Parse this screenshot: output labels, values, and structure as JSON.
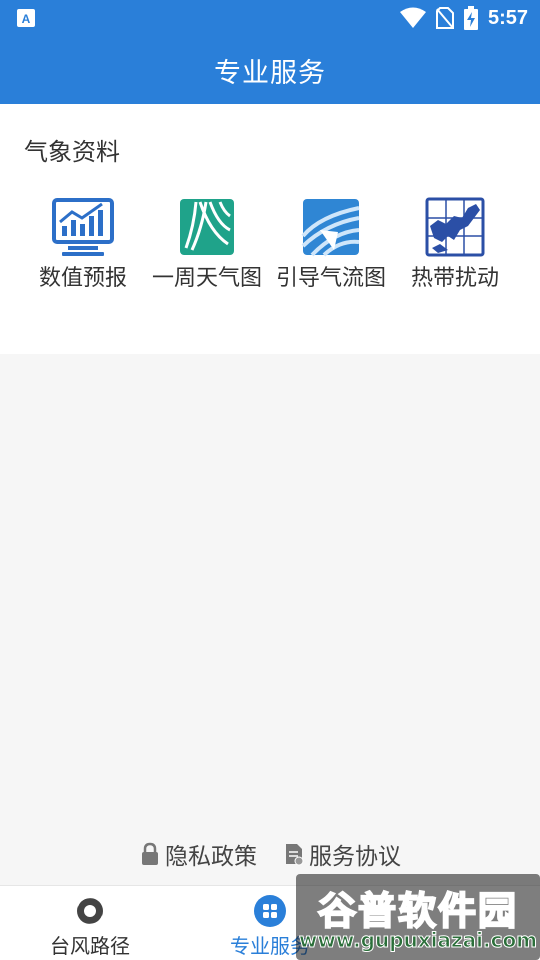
{
  "status_bar": {
    "time": "5:57",
    "left_icon": "app-notification-icon",
    "icons": [
      "wifi-icon",
      "no-sim-icon",
      "battery-charging-icon"
    ]
  },
  "app_bar": {
    "title": "专业服务"
  },
  "section": {
    "title": "气象资料",
    "items": [
      {
        "label": "数值预报",
        "icon": "numerical-forecast-icon"
      },
      {
        "label": "一周天气图",
        "icon": "weekly-weather-map-icon"
      },
      {
        "label": "引导气流图",
        "icon": "steering-flow-map-icon"
      },
      {
        "label": "热带扰动",
        "icon": "tropical-disturbance-icon"
      }
    ]
  },
  "footer_links": [
    {
      "label": "隐私政策",
      "icon": "lock-icon"
    },
    {
      "label": "服务协议",
      "icon": "document-icon"
    }
  ],
  "tabs": [
    {
      "label": "台风路径",
      "icon": "typhoon-icon",
      "active": false
    },
    {
      "label": "专业服务",
      "icon": "grid-icon",
      "active": true
    },
    {
      "label": "",
      "icon": "",
      "active": false
    }
  ],
  "watermark": {
    "title": "谷普软件园",
    "url": "www.gupuxiazai.com"
  },
  "colors": {
    "primary": "#2a7fd9",
    "text": "#333333",
    "background": "#f6f6f6"
  }
}
